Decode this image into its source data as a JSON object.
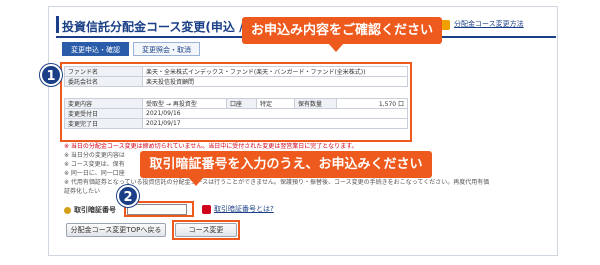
{
  "header": {
    "title": "投資信託分配金コース変更(申込 / 確認",
    "help_link": "分配金コース変更方法"
  },
  "tabs": [
    {
      "label": "変更申込・確認",
      "active": true
    },
    {
      "label": "変更照会・取消",
      "active": false
    }
  ],
  "callouts": {
    "confirm": "お申込み内容をご確認ください",
    "enter_password": "取引暗証番号を入力のうえ、お申込みください"
  },
  "badges": {
    "step1": "1",
    "step2": "2"
  },
  "fund_info": {
    "fund_name_label": "ファンド名",
    "fund_name_value": "楽天・全米株式インデックス・ファンド(楽天・バンガード・ファンド(全米株式))",
    "company_label": "委託会社名",
    "company_value": "楽天投信投資顧問"
  },
  "change_info": {
    "content_label": "変更内容",
    "content_value": "受取型 → 再投資型",
    "account_label": "口座",
    "account_value": "特定",
    "holding_label": "保有数量",
    "holding_value": "1,570 口",
    "accepted_label": "変更受付日",
    "accepted_value": "2021/09/16",
    "completed_label": "変更完了日",
    "completed_value": "2021/09/17"
  },
  "notes": [
    {
      "text": "※ 当日の分配金コース変更は締め切られていません。当日中に受付された変更は翌営業日に完了となります。",
      "red": true
    },
    {
      "text": "※ 当日分の変更内容は",
      "red": false
    },
    {
      "text": "※ コース変更は、保有",
      "red": false
    },
    {
      "text": "※ 同一日に、同一口座",
      "red": false
    },
    {
      "text": "※ 代用有価証券となっている投資信託の分配金コースは行うことができません。保護預り・振替後、コース変更の手続きをおこなってください。再度代用有価",
      "red": false
    },
    {
      "text": "証券化したい",
      "red": false
    }
  ],
  "password": {
    "label": "取引暗証番号",
    "value": "",
    "help_link": "取引暗証番号とは?"
  },
  "buttons": {
    "back": "分配金コース変更TOPへ戻る",
    "submit": "コース変更"
  },
  "colors": {
    "accent": "#ee5a1d",
    "brand": "#1b3f86",
    "note_red": "#d0021b"
  }
}
